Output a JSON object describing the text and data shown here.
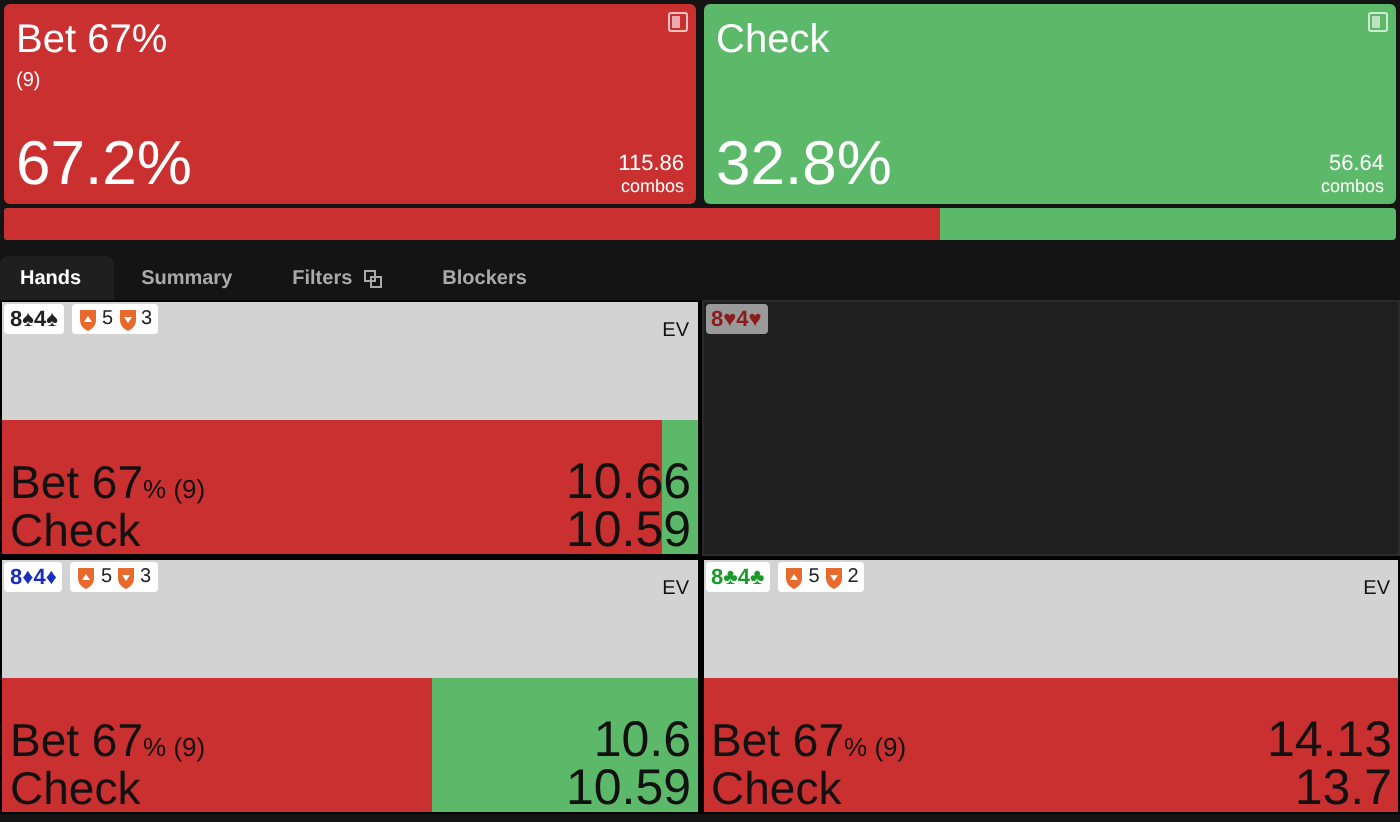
{
  "actions": [
    {
      "title": "Bet 67%",
      "subtitle": "(9)",
      "percent": "67.2%",
      "combos": "115.86",
      "combos_label": "combos",
      "color": "#cb3030"
    },
    {
      "title": "Check",
      "percent": "32.8%",
      "combos": "56.64",
      "combos_label": "combos",
      "color": "#5cb96a"
    }
  ],
  "frequency_bar": {
    "level": 0.672
  },
  "tabs": [
    {
      "label": "Hands",
      "selected": true
    },
    {
      "label": "Summary",
      "selected": false
    },
    {
      "label": "Filters",
      "selected": false,
      "icon": true
    },
    {
      "label": "Blockers",
      "selected": false
    }
  ],
  "hands": [
    {
      "kind": "hand",
      "cards": "8♠4♠",
      "color": "#222222",
      "blockers_up": "5",
      "blockers_down": "3",
      "ev_label": "EV",
      "level": 0.95,
      "rows": [
        {
          "label": "Bet 67",
          "unit": "%",
          "note": "(9)",
          "ev": "10.66"
        },
        {
          "label": "Check",
          "ev": "10.59"
        }
      ]
    },
    {
      "kind": "empty",
      "cards": "8♥4♥",
      "color": "#8b1c1c"
    },
    {
      "kind": "hand",
      "cards": "8♦4♦",
      "color": "#1a2fbf",
      "blockers_up": "5",
      "blockers_down": "3",
      "ev_label": "EV",
      "level": 0.62,
      "rows": [
        {
          "label": "Bet 67",
          "unit": "%",
          "note": "(9)",
          "ev": "10.6"
        },
        {
          "label": "Check",
          "ev": "10.59"
        }
      ]
    },
    {
      "kind": "hand",
      "cards": "8♣4♣",
      "color": "#1a9a2a",
      "blockers_up": "5",
      "blockers_down": "2",
      "ev_label": "EV",
      "level": 1,
      "rows": [
        {
          "label": "Bet 67",
          "unit": "%",
          "note": "(9)",
          "ev": "14.13"
        },
        {
          "label": "Check",
          "ev": "13.7"
        }
      ]
    }
  ]
}
